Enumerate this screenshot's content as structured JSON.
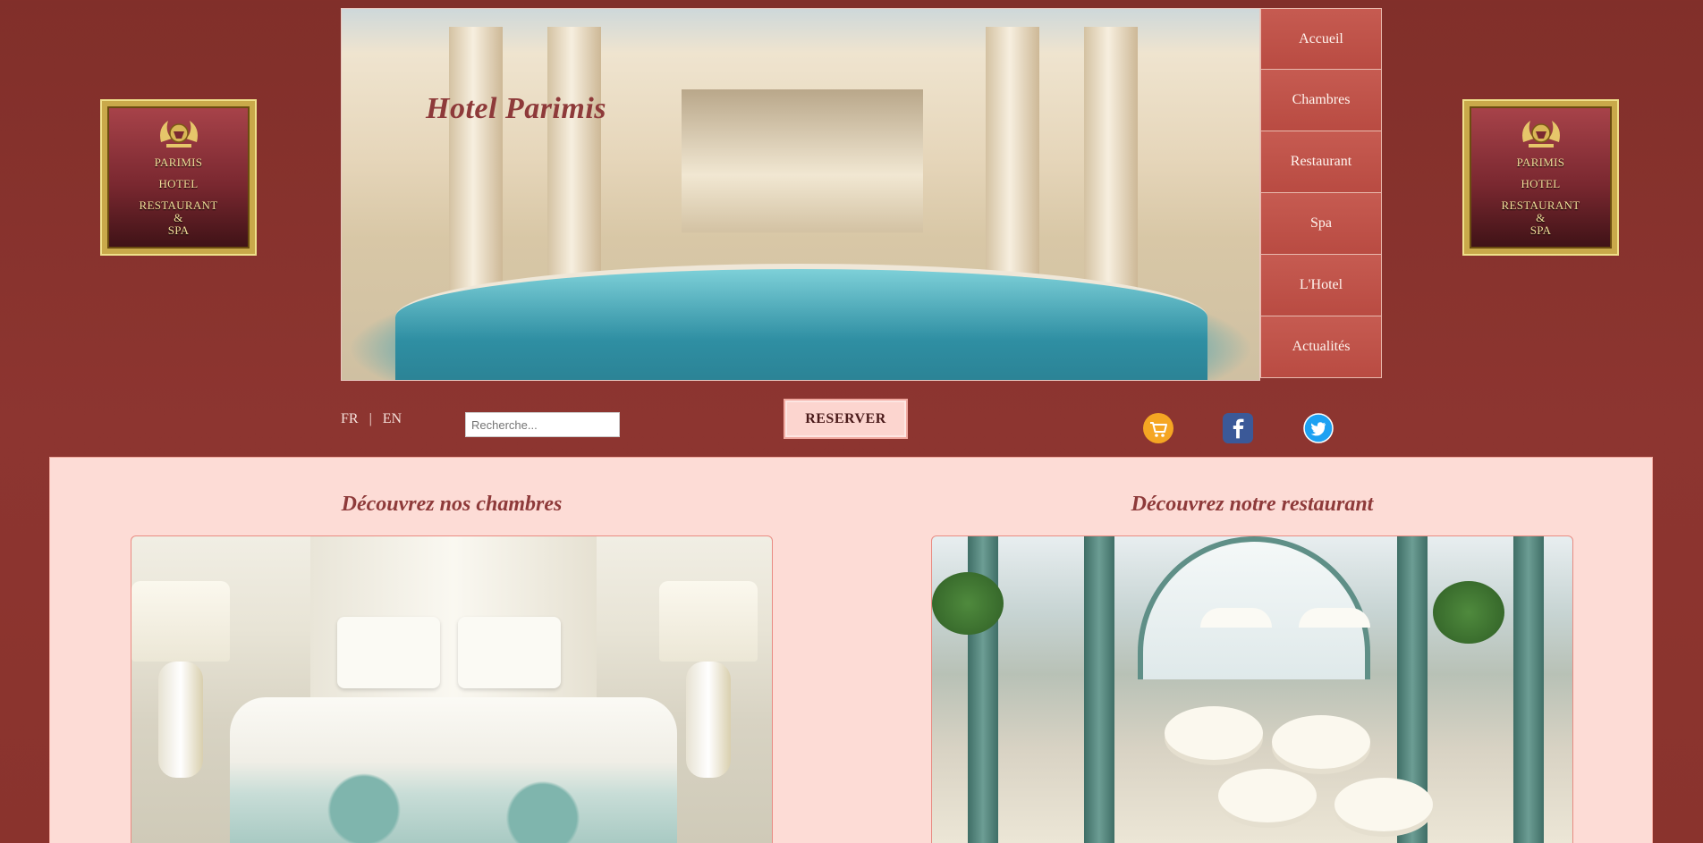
{
  "logo": {
    "lines": [
      "PARIMIS",
      "HOTEL",
      "RESTAURANT",
      "&",
      "SPA"
    ]
  },
  "banner": {
    "title": "Hotel Parimis"
  },
  "nav": {
    "items": [
      "Accueil",
      "Chambres",
      "Restaurant",
      "Spa",
      "L'Hotel",
      "Actualités"
    ]
  },
  "toolbar": {
    "lang_fr": "FR",
    "lang_sep": "|",
    "lang_en": "EN",
    "search_placeholder": "Recherche...",
    "reserve_label": "RESERVER"
  },
  "social": {
    "icons": [
      "cart-icon",
      "facebook-icon",
      "twitter-icon"
    ],
    "colors": {
      "cart": "#f5a623",
      "facebook": "#3b5998",
      "twitter": "#1da1f2"
    }
  },
  "sections": {
    "rooms_title": "Découvrez nos chambres",
    "restaurant_title": "Découvrez notre restaurant"
  },
  "colors": {
    "background": "#8a332d",
    "nav_bg": "#c0524a",
    "panel_bg": "#fddcd6",
    "title_color": "#8e3a3a",
    "gold": "#c9a94a"
  }
}
